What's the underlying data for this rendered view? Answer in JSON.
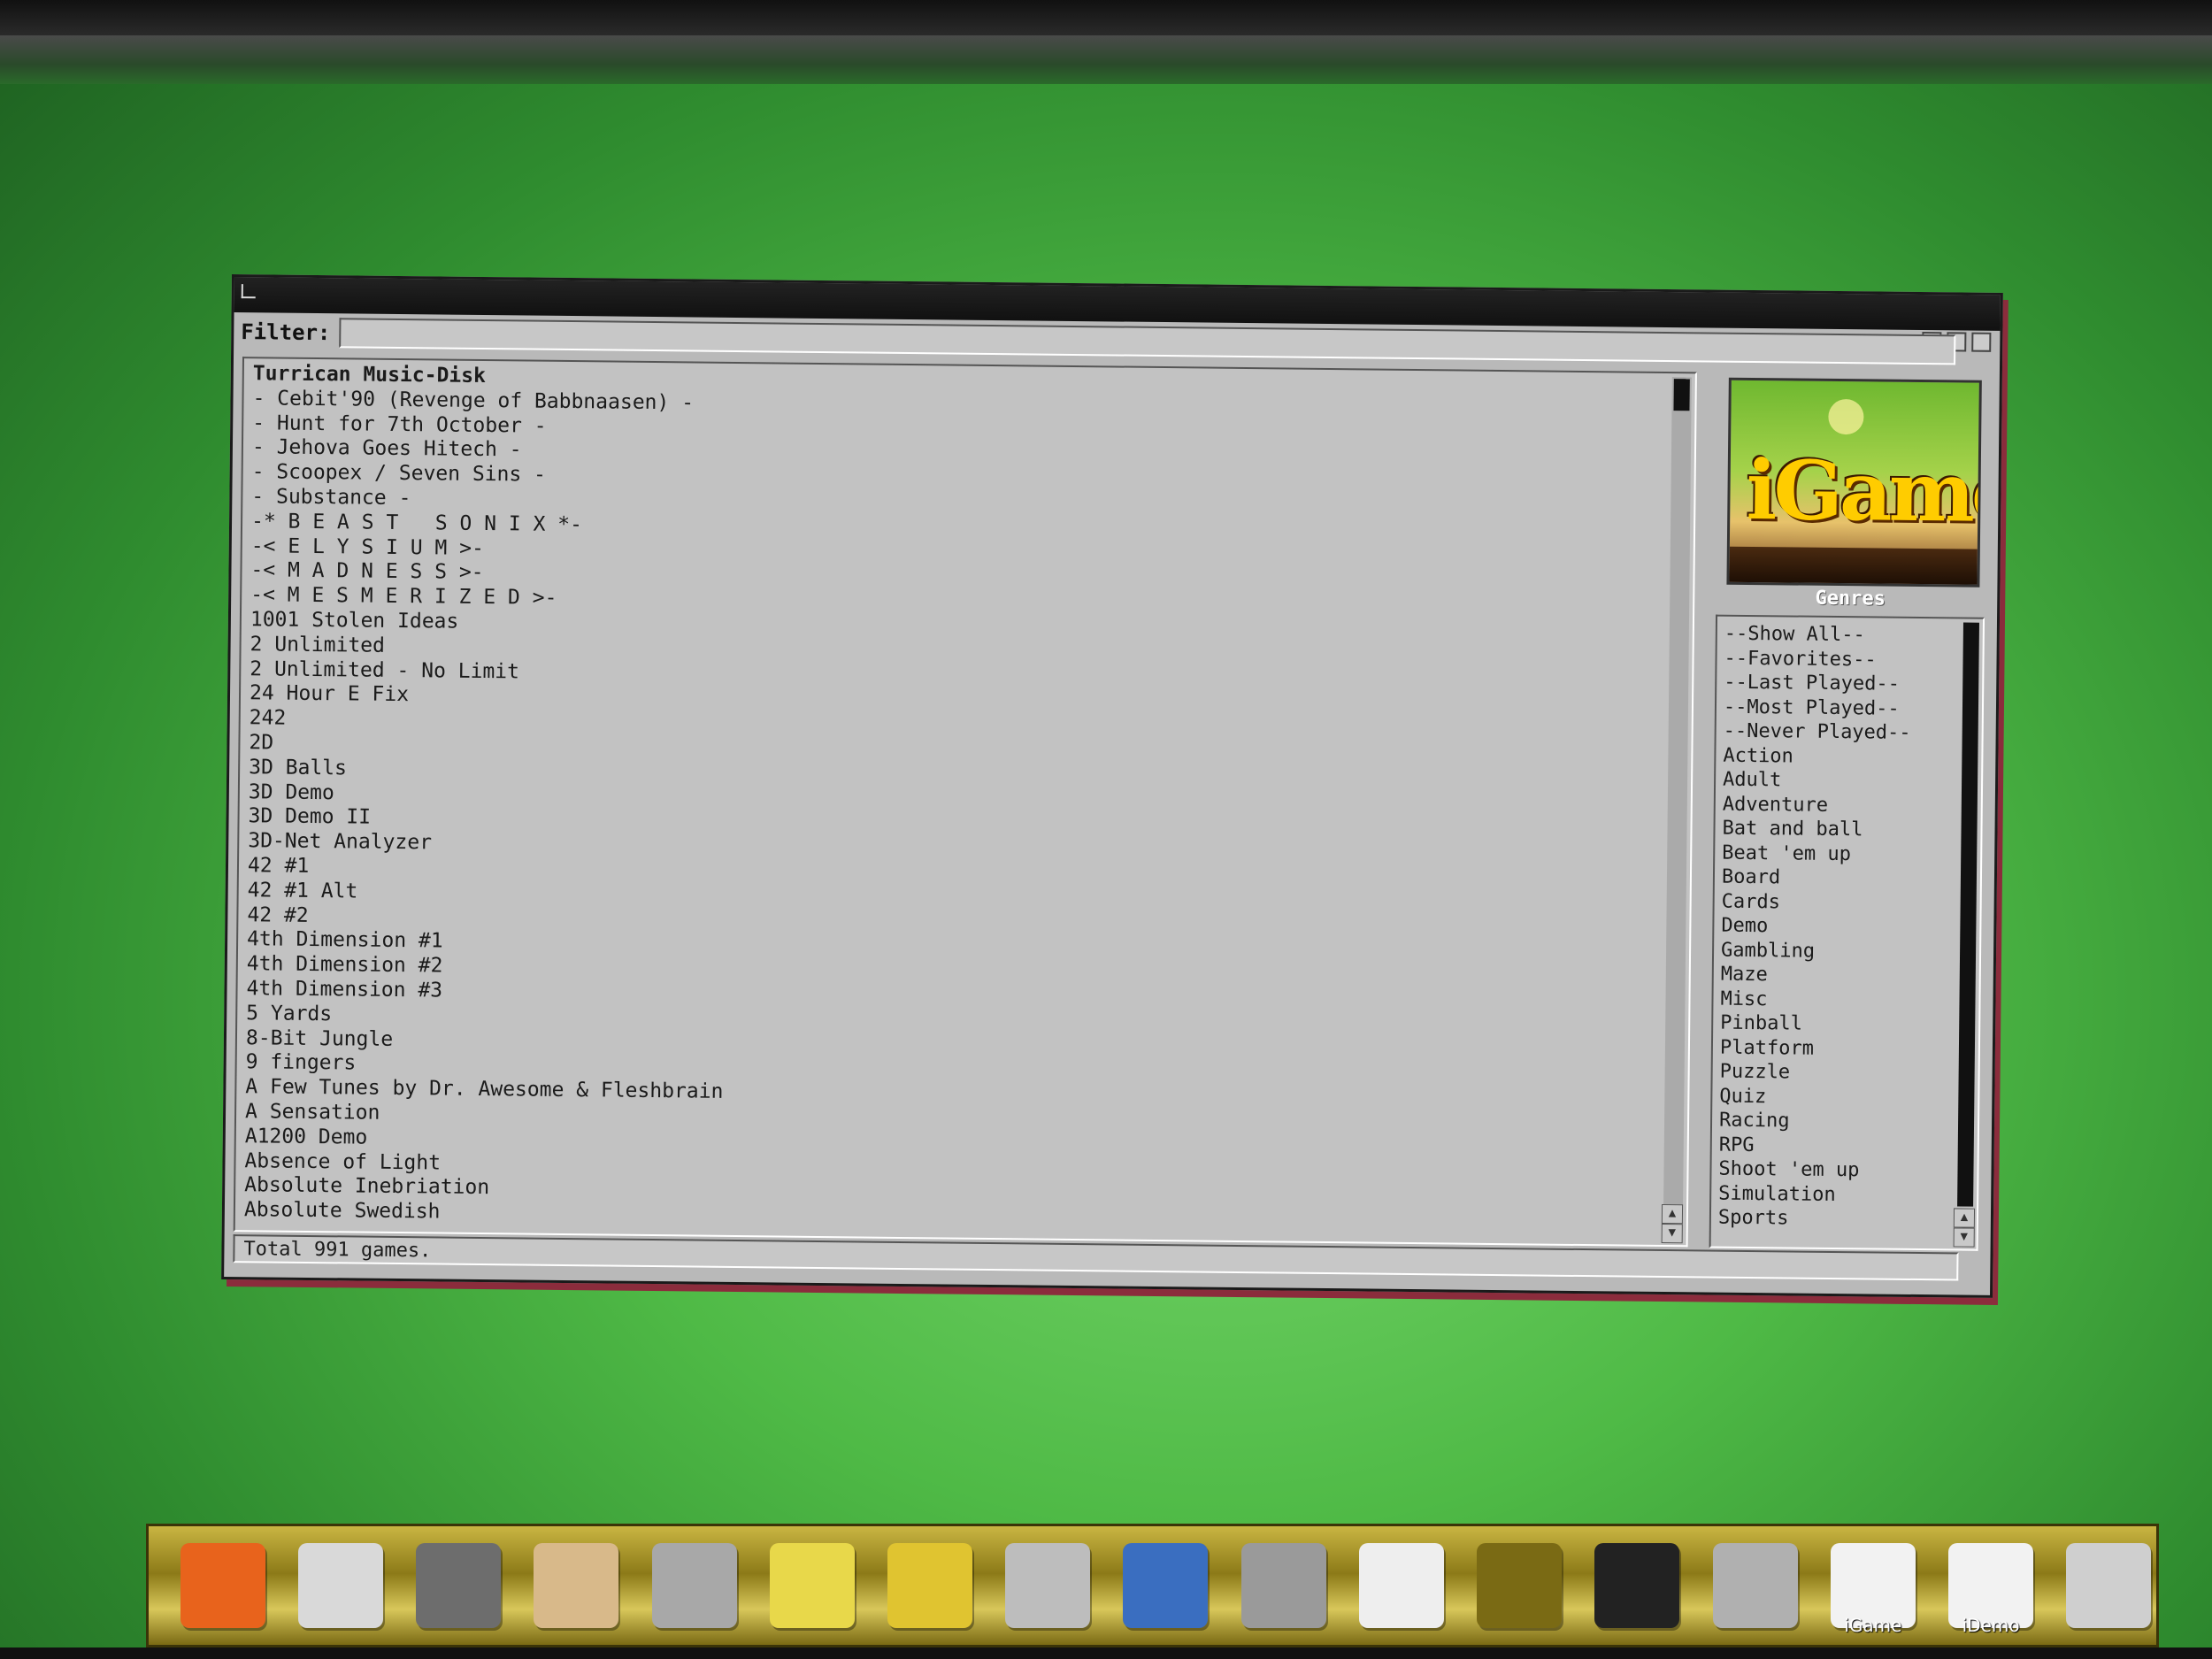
{
  "window": {
    "filter_label": "Filter:",
    "filter_value": "",
    "status": "Total 991 games."
  },
  "games": [
    "Turrican Music-Disk",
    "- Cebit'90 (Revenge of Babbnaasen) -",
    "- Hunt for 7th October -",
    "- Jehova Goes Hitech -",
    "- Scoopex / Seven Sins -",
    "- Substance -",
    "-* B E A S T   S O N I X *-",
    "-< E L Y S I U M >-",
    "-< M A D N E S S >-",
    "-< M E S M E R I Z E D >-",
    "1001 Stolen Ideas",
    "2 Unlimited",
    "2 Unlimited - No Limit",
    "24 Hour E Fix",
    "242",
    "2D",
    "3D Balls",
    "3D Demo",
    "3D Demo II",
    "3D-Net Analyzer",
    "42 #1",
    "42 #1 Alt",
    "42 #2",
    "4th Dimension #1",
    "4th Dimension #2",
    "4th Dimension #3",
    "5 Yards",
    "8-Bit Jungle",
    "9 fingers",
    "A Few Tunes by Dr. Awesome & Fleshbrain",
    "A Sensation",
    "A1200 Demo",
    "Absence of Light",
    "Absolute Inebriation",
    "Absolute Swedish"
  ],
  "logo": {
    "text": "iGame"
  },
  "genres_label": "Genres",
  "genres": [
    "--Show All--",
    "--Favorites--",
    "--Last Played--",
    "--Most Played--",
    "--Never Played--",
    "Action",
    "Adult",
    "Adventure",
    "Bat and ball",
    "Beat 'em up",
    "Board",
    "Cards",
    "Demo",
    "Gambling",
    "Maze",
    "Misc",
    "Pinball",
    "Platform",
    "Puzzle",
    "Quiz",
    "Racing",
    "RPG",
    "Shoot 'em up",
    "Simulation",
    "Sports"
  ],
  "dock": [
    {
      "icon": "firefox-icon",
      "label": "",
      "color": "#e8631c"
    },
    {
      "icon": "globe-icon",
      "label": "",
      "color": "#d9d9d9"
    },
    {
      "icon": "monitor-icon",
      "label": "",
      "color": "#6d6d6d"
    },
    {
      "icon": "notepad-icon",
      "label": "",
      "color": "#d8b98a"
    },
    {
      "icon": "drive-icon",
      "label": "",
      "color": "#a8a8a8"
    },
    {
      "icon": "prefs-icon",
      "label": "",
      "color": "#e8d84a"
    },
    {
      "icon": "cd-icon",
      "label": "",
      "color": "#e0c430"
    },
    {
      "icon": "mixer-icon",
      "label": "",
      "color": "#bdbdbd"
    },
    {
      "icon": "screen-icon",
      "label": "",
      "color": "#3a6ec0"
    },
    {
      "icon": "search-icon",
      "label": "",
      "color": "#9a9a9a"
    },
    {
      "icon": "display-icon",
      "label": "",
      "color": "#eeeeee"
    },
    {
      "icon": "amp-icon",
      "label": "",
      "color": "#7a6a14"
    },
    {
      "icon": "clapper-icon",
      "label": "",
      "color": "#222222"
    },
    {
      "icon": "music-icon",
      "label": "",
      "color": "#b0b0b0"
    },
    {
      "icon": "joystick-icon",
      "label": "iGame",
      "color": "#f2f2f2"
    },
    {
      "icon": "boing-ball-icon",
      "label": "iDemo",
      "color": "#f2f2f2"
    },
    {
      "icon": "editor-icon",
      "label": "",
      "color": "#cfcfcf"
    }
  ]
}
